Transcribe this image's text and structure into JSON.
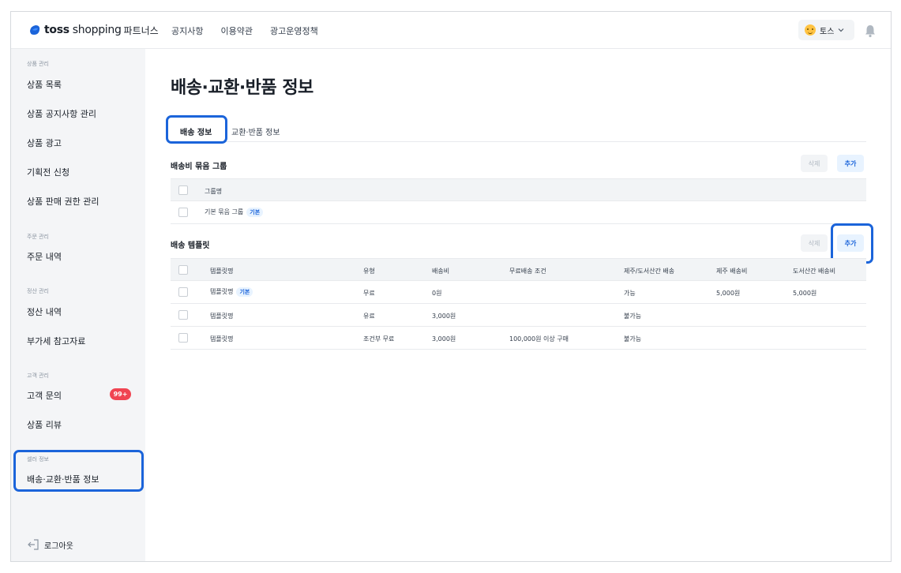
{
  "header": {
    "brand": "toss",
    "brand_sub": "shopping",
    "brand_partners": "파트너스",
    "nav": [
      "공지사항",
      "이용약관",
      "광고운영정책"
    ],
    "user_name": "토스"
  },
  "sidebar": {
    "sections": [
      {
        "label": "상품 관리",
        "items": [
          "상품 목록",
          "상품 공지사항 관리",
          "상품 광고",
          "기획전 신청",
          "상품 판매 권한 관리"
        ]
      },
      {
        "label": "주문 관리",
        "items": [
          "주문 내역"
        ]
      },
      {
        "label": "정산 관리",
        "items": [
          "정산 내역",
          "부가세 참고자료"
        ]
      },
      {
        "label": "고객 관리",
        "items": [
          "고객 문의",
          "상품 리뷰"
        ]
      },
      {
        "label": "셀러 정보",
        "items": [
          "배송·교환·반품 정보"
        ]
      }
    ],
    "inquiry_badge": "99+",
    "logout": "로그아웃"
  },
  "main": {
    "title": "배송·교환·반품 정보",
    "tabs": [
      "배송 정보",
      "교환·반품 정보"
    ],
    "group": {
      "title": "배송비 묶음 그룹",
      "delete": "삭제",
      "add": "추가",
      "header": "그룹명",
      "rows": [
        {
          "name": "기본 묶음 그룹",
          "tag": "기본"
        }
      ]
    },
    "template": {
      "title": "배송 템플릿",
      "delete": "삭제",
      "add": "추가",
      "headers": [
        "템플릿명",
        "유형",
        "배송비",
        "무료배송 조건",
        "제주/도서산간 배송",
        "제주 배송비",
        "도서산간 배송비"
      ],
      "rows": [
        {
          "name": "템플릿명",
          "tag": "기본",
          "type": "무료",
          "fee": "0원",
          "free": "",
          "island": "가능",
          "jeju": "5,000원",
          "remote": "5,000원"
        },
        {
          "name": "템플릿명",
          "tag": "",
          "type": "유료",
          "fee": "3,000원",
          "free": "",
          "island": "불가능",
          "jeju": "",
          "remote": ""
        },
        {
          "name": "템플릿명",
          "tag": "",
          "type": "조건부 무료",
          "fee": "3,000원",
          "free": "100,000원 이상 구매",
          "island": "불가능",
          "jeju": "",
          "remote": ""
        }
      ]
    }
  },
  "colors": {
    "accent": "#1b64da",
    "badge": "#f04452",
    "sidebar_bg": "#f4f5f7"
  }
}
